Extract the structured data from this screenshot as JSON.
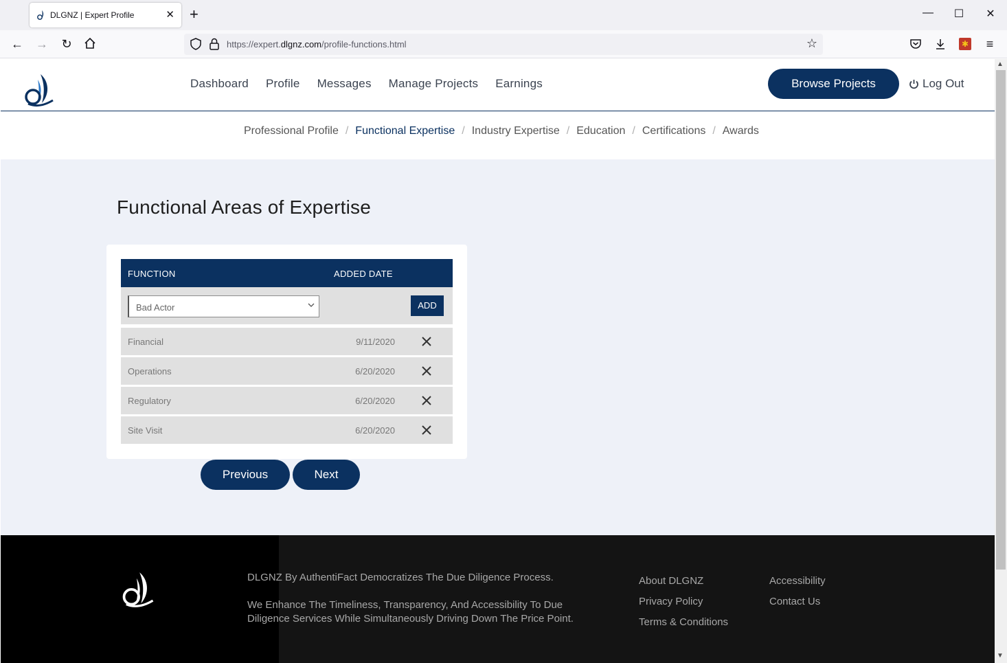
{
  "browser": {
    "tab_title": "DLGNZ | Expert Profile",
    "url_prefix": "https://expert.",
    "url_domain": "dlgnz.com",
    "url_path": "/profile-functions.html"
  },
  "header": {
    "nav": [
      "Dashboard",
      "Profile",
      "Messages",
      "Manage Projects",
      "Earnings"
    ],
    "browse_label": "Browse Projects",
    "logout_label": "Log Out"
  },
  "subnav": {
    "items": [
      "Professional Profile",
      "Functional Expertise",
      "Industry Expertise",
      "Education",
      "Certifications",
      "Awards"
    ],
    "active": "Functional Expertise"
  },
  "main": {
    "title": "Functional Areas of Expertise",
    "columns": {
      "function": "FUNCTION",
      "added_date": "ADDED DATE"
    },
    "select_value": "Bad Actor",
    "add_label": "ADD",
    "rows": [
      {
        "function": "Financial",
        "date": "9/11/2020"
      },
      {
        "function": "Operations",
        "date": "6/20/2020"
      },
      {
        "function": "Regulatory",
        "date": "6/20/2020"
      },
      {
        "function": "Site Visit",
        "date": "6/20/2020"
      }
    ],
    "previous_label": "Previous",
    "next_label": "Next"
  },
  "footer": {
    "tagline": "DLGNZ By AuthentiFact Democratizes The Due Diligence Process.",
    "description": "We Enhance The Timeliness, Transparency, And Accessibility To Due Diligence Services While Simultaneously Driving Down The Price Point.",
    "links_col1": [
      "About DLGNZ",
      "Privacy Policy",
      "Terms & Conditions"
    ],
    "links_col2": [
      "Accessibility",
      "Contact Us"
    ]
  },
  "colors": {
    "brand": "#0b3160",
    "content_bg": "#eef1f8",
    "row_bg": "#e0e0e0"
  }
}
